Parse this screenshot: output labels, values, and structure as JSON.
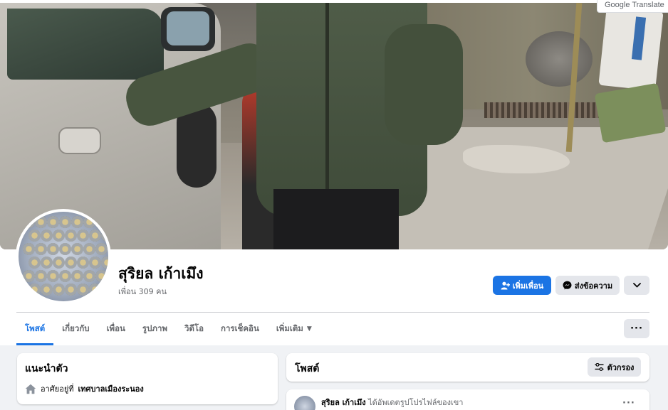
{
  "translate_chip": {
    "label": "Google Translate"
  },
  "profile": {
    "name": "สุริยล เก้าเมึง",
    "friends_count": "เพื่อน 309 คน"
  },
  "actions": {
    "add_friend": "เพิ่มเพื่อน",
    "message": "ส่งข้อความ",
    "more_icon": "chevron-down-icon"
  },
  "tabs": [
    {
      "label": "โพสต์",
      "active": true
    },
    {
      "label": "เกี่ยวกับ",
      "active": false
    },
    {
      "label": "เพื่อน",
      "active": false
    },
    {
      "label": "รูปภาพ",
      "active": false
    },
    {
      "label": "วิดีโอ",
      "active": false
    },
    {
      "label": "การเช็คอิน",
      "active": false
    },
    {
      "label": "เพิ่มเติม",
      "active": false
    }
  ],
  "tabs_more_label": "···",
  "intro": {
    "title": "แนะนำตัว",
    "lives_in_prefix": "อาศัยอยู่ที่",
    "lives_in_place": "เทศบาลเมืองระนอง"
  },
  "posts": {
    "title": "โพสต์",
    "filter_label": "ตัวกรอง"
  },
  "post": {
    "author": "สุริยล เก้าเมึง",
    "action": "ได้อัพเดตรูปโปรไฟล์ของเขา",
    "menu": "···"
  },
  "colors": {
    "primary": "#1b74e4",
    "button_gray": "#e4e6eb",
    "page_bg": "#f0f2f5",
    "secondary_text": "#65676b"
  }
}
